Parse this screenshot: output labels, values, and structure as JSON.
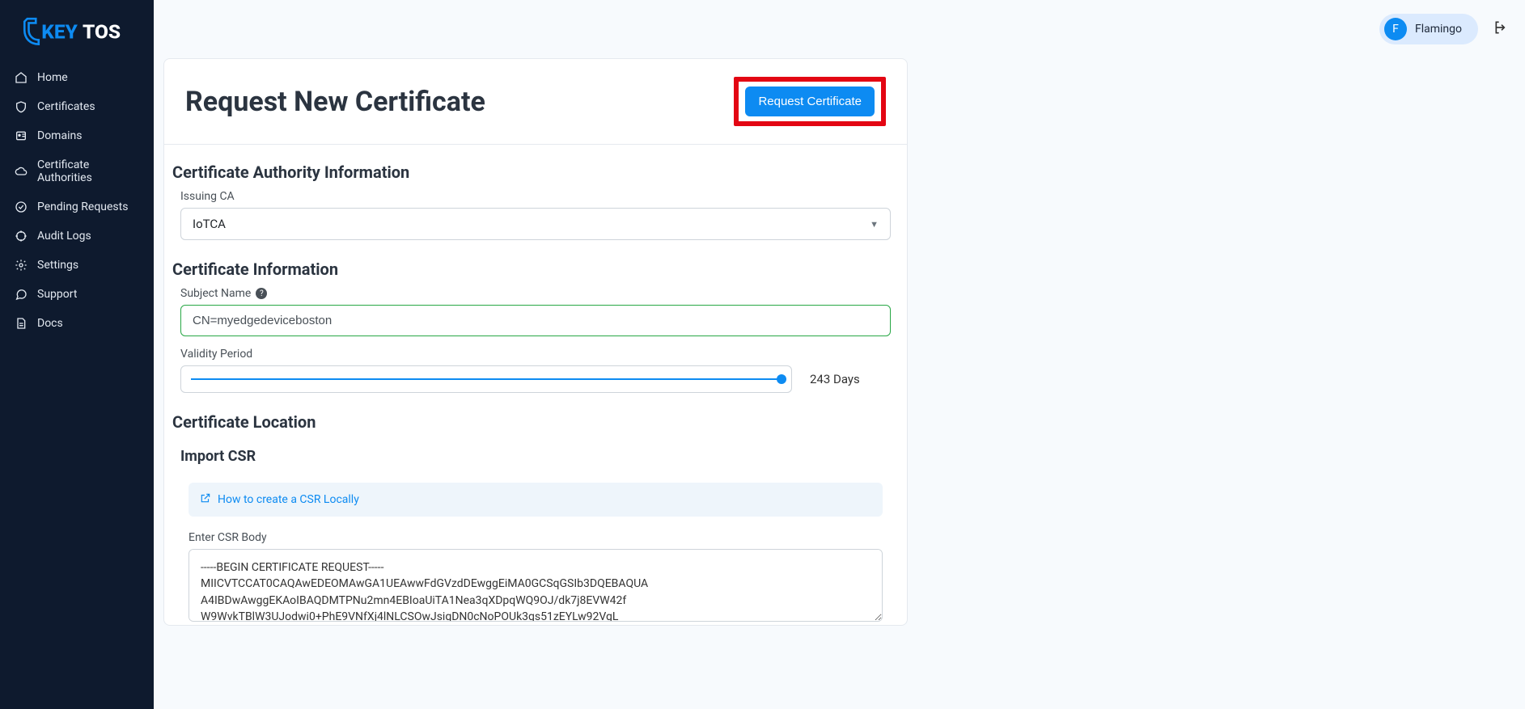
{
  "brand": {
    "name": "KEYTOS"
  },
  "sidebar": {
    "items": [
      {
        "label": "Home",
        "icon": "home-icon"
      },
      {
        "label": "Certificates",
        "icon": "shield-icon"
      },
      {
        "label": "Domains",
        "icon": "id-card-icon"
      },
      {
        "label": "Certificate Authorities",
        "icon": "cloud-icon"
      },
      {
        "label": "Pending Requests",
        "icon": "clock-check-icon"
      },
      {
        "label": "Audit Logs",
        "icon": "crosshair-icon"
      },
      {
        "label": "Settings",
        "icon": "gear-icon"
      },
      {
        "label": "Support",
        "icon": "chat-icon"
      },
      {
        "label": "Docs",
        "icon": "document-icon"
      }
    ]
  },
  "topbar": {
    "user_initial": "F",
    "user_name": "Flamingo"
  },
  "page": {
    "title": "Request New Certificate",
    "submit_label": "Request Certificate",
    "sections": {
      "ca_info": {
        "heading": "Certificate Authority Information",
        "issuing_ca_label": "Issuing CA",
        "issuing_ca_value": "IoTCA"
      },
      "cert_info": {
        "heading": "Certificate Information",
        "subject_label": "Subject Name",
        "subject_value": "CN=myedgedeviceboston",
        "validity_label": "Validity Period",
        "validity_value": "243 Days"
      },
      "cert_location": {
        "heading": "Certificate Location",
        "import_heading": "Import CSR",
        "howto_link": "How to create a CSR Locally",
        "csr_label": "Enter CSR Body",
        "csr_value": "-----BEGIN CERTIFICATE REQUEST-----\nMIICVTCCAT0CAQAwEDEOMAwGA1UEAwwFdGVzdDEwggEiMA0GCSqGSIb3DQEBAQUA\nA4IBDwAwggEKAoIBAQDMTPNu2mn4EBIoaUiTA1Nea3qXDpqWQ9OJ/dk7j8EVW42f\nW9WvkTBlW3UJodwi0+PhE9VNfXj4lNLCSOwJsigDN0cNoPOUk3gs51zEYLw92VgL"
      }
    }
  }
}
